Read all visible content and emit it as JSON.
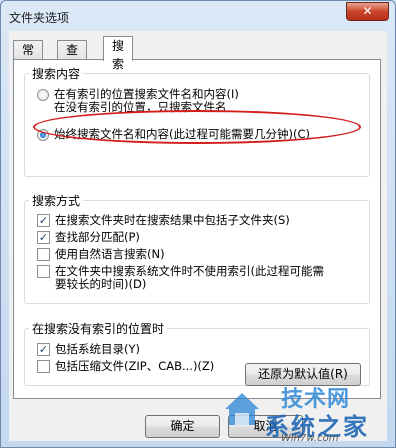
{
  "window": {
    "title": "文件夹选项",
    "close_glyph": "✕"
  },
  "tabs": [
    {
      "label": "常规"
    },
    {
      "label": "查看"
    },
    {
      "label": "搜索"
    }
  ],
  "search_content": {
    "title": "搜索内容",
    "option1_line1": "在有索引的位置搜索文件名和内容(I)",
    "option1_line2": "在没有索引的位置，只搜索文件名",
    "option2": "始终搜索文件名和内容(此过程可能需要几分钟)(C)"
  },
  "search_method": {
    "title": "搜索方式",
    "items": [
      {
        "label": "在搜索文件夹时在搜索结果中包括子文件夹(S)",
        "checked": true
      },
      {
        "label": "查找部分匹配(P)",
        "checked": true
      },
      {
        "label": "使用自然语言搜索(N)",
        "checked": false
      },
      {
        "label": "在文件夹中搜索系统文件时不使用索引(此过程可能需",
        "label2": "要较长的时间)(D)",
        "checked": false
      }
    ]
  },
  "no_index": {
    "title": "在搜索没有索引的位置时",
    "items": [
      {
        "label": "包括系统目录(Y)",
        "checked": true
      },
      {
        "label": "包括压缩文件(ZIP、CAB...)(Z)",
        "checked": false
      }
    ]
  },
  "buttons": {
    "restore": "还原为默认值(R)",
    "ok": "确定",
    "cancel": "取消"
  },
  "watermark": {
    "line1": "技术网",
    "line2": "系统之家",
    "line3": "Win7w.com"
  },
  "colors": {
    "highlight_ellipse": "#d31c1c",
    "close_button": "#c9452b"
  }
}
